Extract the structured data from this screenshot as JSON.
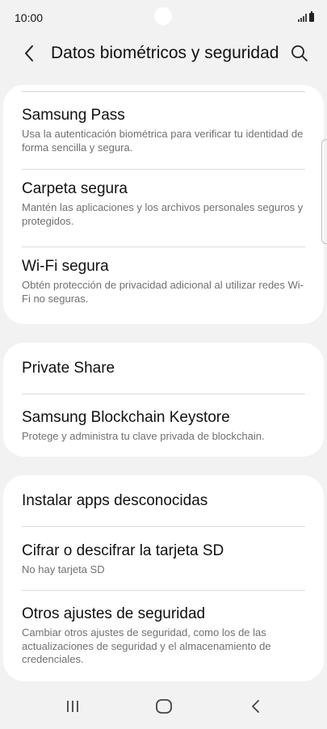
{
  "status_bar": {
    "time": "10:00",
    "icons": [
      "signal-icon",
      "battery-icon"
    ]
  },
  "header": {
    "title": "Datos biométricos y seguridad",
    "back_icon": "chevron-left-icon",
    "search_icon": "search-icon"
  },
  "sections": [
    {
      "items": [
        {
          "title": "Samsung Pass",
          "subtitle": "Usa la autenticación biométrica para verificar tu identidad de forma sencilla y segura."
        },
        {
          "title": "Carpeta segura",
          "subtitle": "Mantén las aplicaciones y los archivos personales seguros y protegidos."
        },
        {
          "title": "Wi-Fi segura",
          "subtitle": "Obtén protección de privacidad adicional al utilizar redes Wi-Fi no seguras."
        }
      ]
    },
    {
      "items": [
        {
          "title": "Private Share",
          "subtitle": ""
        },
        {
          "title": "Samsung Blockchain Keystore",
          "subtitle": "Protege y administra tu clave privada de blockchain."
        }
      ]
    },
    {
      "items": [
        {
          "title": "Instalar apps desconocidas",
          "subtitle": ""
        },
        {
          "title": "Cifrar o descifrar la tarjeta SD",
          "subtitle": "No hay tarjeta SD"
        },
        {
          "title": "Otros ajustes de seguridad",
          "subtitle": "Cambiar otros ajustes de seguridad, como los de las actualizaciones de seguridad y el almacenamiento de credenciales."
        }
      ]
    }
  ],
  "nav_bar": {
    "icons": [
      "recents-icon",
      "home-icon",
      "back-icon"
    ]
  },
  "colors": {
    "background": "#f2f2f2",
    "card": "#ffffff",
    "title_text": "#111111",
    "subtitle_text": "#707070",
    "divider": "#dcdcdc"
  }
}
